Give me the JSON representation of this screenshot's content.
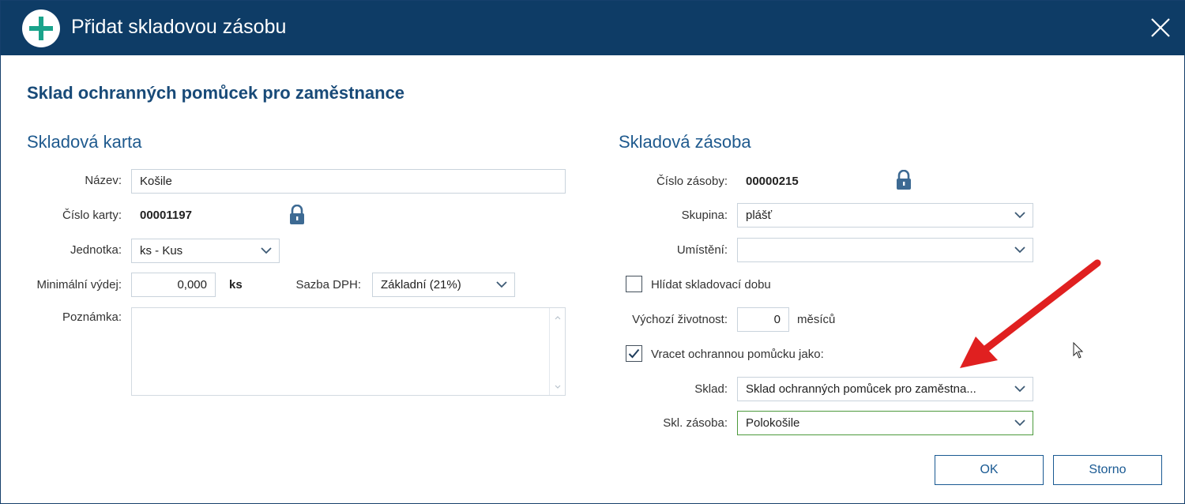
{
  "dialog": {
    "title": "Přidat skladovou zásobu",
    "heading": "Sklad ochranných pomůcek pro zaměstnance",
    "title_icon": "plus-circle-icon",
    "close_icon": "close-icon",
    "colors": {
      "titlebar": "#0e3c66",
      "plus": "#1aa38b",
      "heading": "#184a78",
      "accent_green": "#4c9a3c",
      "arrow": "#e02020"
    }
  },
  "card": {
    "section_title": "Skladová karta",
    "name_label": "Název:",
    "name_value": "Košile",
    "card_number_label": "Číslo karty:",
    "card_number_value": "00001197",
    "unit_label": "Jednotka:",
    "unit_value": "ks - Kus",
    "min_issue_label": "Minimální výdej:",
    "min_issue_value": "0,000",
    "min_issue_unit": "ks",
    "vat_label": "Sazba DPH:",
    "vat_value": "Základní (21%)",
    "note_label": "Poznámka:",
    "note_value": ""
  },
  "stock": {
    "section_title": "Skladová zásoba",
    "stock_number_label": "Číslo zásoby:",
    "stock_number_value": "00000215",
    "group_label": "Skupina:",
    "group_value": "plášť",
    "location_label": "Umístění:",
    "location_value": "",
    "watch_storage_label": "Hlídat skladovací dobu",
    "watch_storage_checked": false,
    "default_life_label": "Výchozí životnost:",
    "default_life_value": "0",
    "default_life_unit": "měsíců",
    "return_as_label": "Vracet ochrannou pomůcku jako:",
    "return_as_checked": true,
    "warehouse_label": "Sklad:",
    "warehouse_value": "Sklad ochranných pomůcek pro zaměstna...",
    "stock_item_label": "Skl. zásoba:",
    "stock_item_value": "Polokošile"
  },
  "buttons": {
    "ok": "OK",
    "cancel": "Storno"
  }
}
